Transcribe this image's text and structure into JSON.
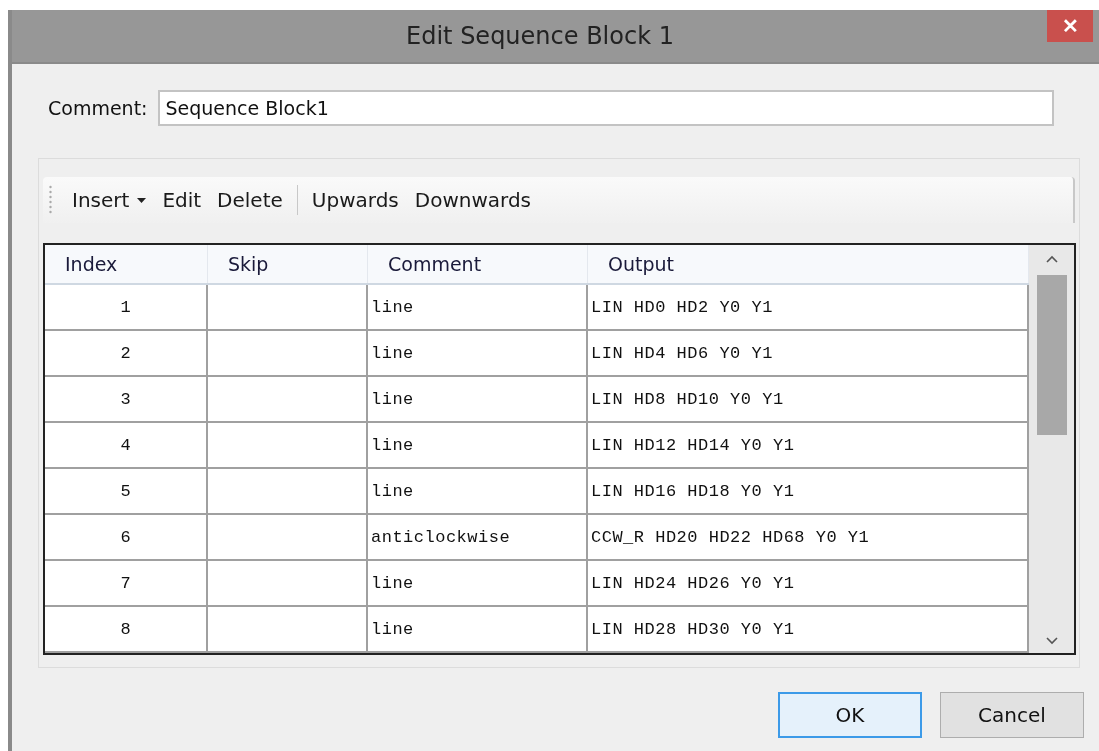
{
  "window": {
    "title": "Edit Sequence Block 1",
    "close": "✕"
  },
  "comment": {
    "label": "Comment:",
    "value": "Sequence Block1"
  },
  "toolbar": [
    {
      "kind": "dropdown",
      "label": "Insert"
    },
    {
      "kind": "button",
      "label": "Edit"
    },
    {
      "kind": "button",
      "label": "Delete"
    },
    {
      "kind": "separator"
    },
    {
      "kind": "button",
      "label": "Upwards"
    },
    {
      "kind": "button",
      "label": "Downwards"
    }
  ],
  "table": {
    "columns": [
      "Index",
      "Skip",
      "Comment",
      "Output"
    ],
    "rows": [
      {
        "index": "1",
        "comment": "line",
        "output": "LIN HD0 HD2 Y0 Y1"
      },
      {
        "index": "2",
        "comment": "line",
        "output": "LIN HD4 HD6 Y0 Y1"
      },
      {
        "index": "3",
        "comment": "line",
        "output": "LIN HD8 HD10 Y0 Y1"
      },
      {
        "index": "4",
        "comment": "line",
        "output": "LIN HD12 HD14 Y0 Y1"
      },
      {
        "index": "5",
        "comment": "line",
        "output": "LIN HD16 HD18 Y0 Y1"
      },
      {
        "index": "6",
        "comment": "anticlockwise",
        "output": "CCW_R HD20 HD22 HD68 Y0 Y1"
      },
      {
        "index": "7",
        "comment": "line",
        "output": "LIN HD24 HD26 Y0 Y1"
      },
      {
        "index": "8",
        "comment": "line",
        "output": "LIN HD28 HD30 Y0 Y1"
      }
    ]
  },
  "buttons": [
    {
      "label": "OK",
      "selected": true
    },
    {
      "label": "Cancel",
      "selected": false
    }
  ]
}
